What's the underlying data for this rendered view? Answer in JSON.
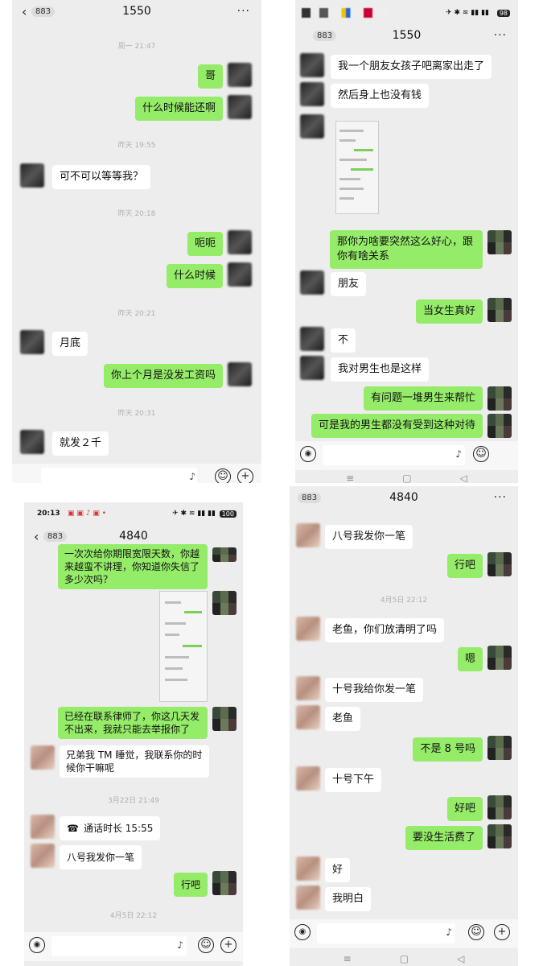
{
  "panel1": {
    "title": "1550",
    "badge": "883",
    "back": "‹",
    "more": "···",
    "messages": [
      {
        "type": "time",
        "text": "周一 21:47"
      },
      {
        "type": "out",
        "text": "哥"
      },
      {
        "type": "out",
        "text": "什么时候能还啊"
      },
      {
        "type": "time",
        "text": "昨天 19:55"
      },
      {
        "type": "in",
        "text": "可不可以等等我？"
      },
      {
        "type": "time",
        "text": "昨天 20:18"
      },
      {
        "type": "out",
        "text": "呃呃"
      },
      {
        "type": "out",
        "text": "什么时候"
      },
      {
        "type": "time",
        "text": "昨天 20:21"
      },
      {
        "type": "in",
        "text": "月底"
      },
      {
        "type": "out",
        "text": "你上个月是没发工资吗"
      },
      {
        "type": "time",
        "text": "昨天 20:31"
      },
      {
        "type": "in",
        "text": "就发２千"
      }
    ]
  },
  "panel2": {
    "title": "1550",
    "badge": "883",
    "more": "···",
    "status_battery": "98",
    "messages": [
      {
        "type": "in",
        "text": "我一个朋友女孩子吧离家出走了"
      },
      {
        "type": "in",
        "text": "然后身上也没有钱"
      },
      {
        "type": "in-image",
        "text": ""
      },
      {
        "type": "out",
        "text": "那你为啥要突然这么好心，跟你有啥关系"
      },
      {
        "type": "in",
        "text": "朋友"
      },
      {
        "type": "out",
        "text": "当女生真好"
      },
      {
        "type": "in",
        "text": "不"
      },
      {
        "type": "in",
        "text": "我对男生也是这样"
      },
      {
        "type": "out",
        "text": "有问题一堆男生来帮忙"
      },
      {
        "type": "out",
        "text": "可是我的男生都没有受到这种对待"
      }
    ]
  },
  "panel3": {
    "title": "4840",
    "badge": "883",
    "back": "‹",
    "status_time": "20:13",
    "status_battery": "100",
    "messages": [
      {
        "type": "out",
        "text": "一次次给你期限宽限天数，你越来越蛮不讲理，你知道你失信了多少次吗？"
      },
      {
        "type": "out-image",
        "text": ""
      },
      {
        "type": "out",
        "text": "已经在联系律师了，你这几天发不出来，我就只能去举报你了"
      },
      {
        "type": "in",
        "text": "兄弟我 TM 睡觉，我联系你的时候你干嘛呢"
      },
      {
        "type": "time",
        "text": "3月22日 21:49"
      },
      {
        "type": "in",
        "text": "通话时长 15:55"
      },
      {
        "type": "in",
        "text": "八号我发你一笔"
      },
      {
        "type": "out",
        "text": "行吧"
      },
      {
        "type": "time",
        "text": "4月5日 22:12"
      }
    ]
  },
  "panel4": {
    "title": "4840",
    "badge": "883",
    "more": "···",
    "messages": [
      {
        "type": "in",
        "text": "八号我发你一笔"
      },
      {
        "type": "out",
        "text": "行吧"
      },
      {
        "type": "time",
        "text": "4月5日 22:12"
      },
      {
        "type": "in",
        "text": "老鱼，你们放清明了吗"
      },
      {
        "type": "out",
        "text": "嗯"
      },
      {
        "type": "in",
        "text": "十号我给你发一笔"
      },
      {
        "type": "in",
        "text": "老鱼"
      },
      {
        "type": "out",
        "text": "不是 8 号吗"
      },
      {
        "type": "in",
        "text": "十号下午"
      },
      {
        "type": "out",
        "text": "好吧"
      },
      {
        "type": "out",
        "text": "要没生活费了"
      },
      {
        "type": "in",
        "text": "好"
      },
      {
        "type": "in",
        "text": "我明白"
      }
    ]
  },
  "icons": {
    "voice": "🔊",
    "emoji": "☺",
    "plus": "+",
    "mic": "🎤",
    "call": "☎"
  },
  "colors": {
    "out_bubble": "#95ec69",
    "in_bubble": "#ffffff",
    "chat_bg": "#ededed"
  }
}
